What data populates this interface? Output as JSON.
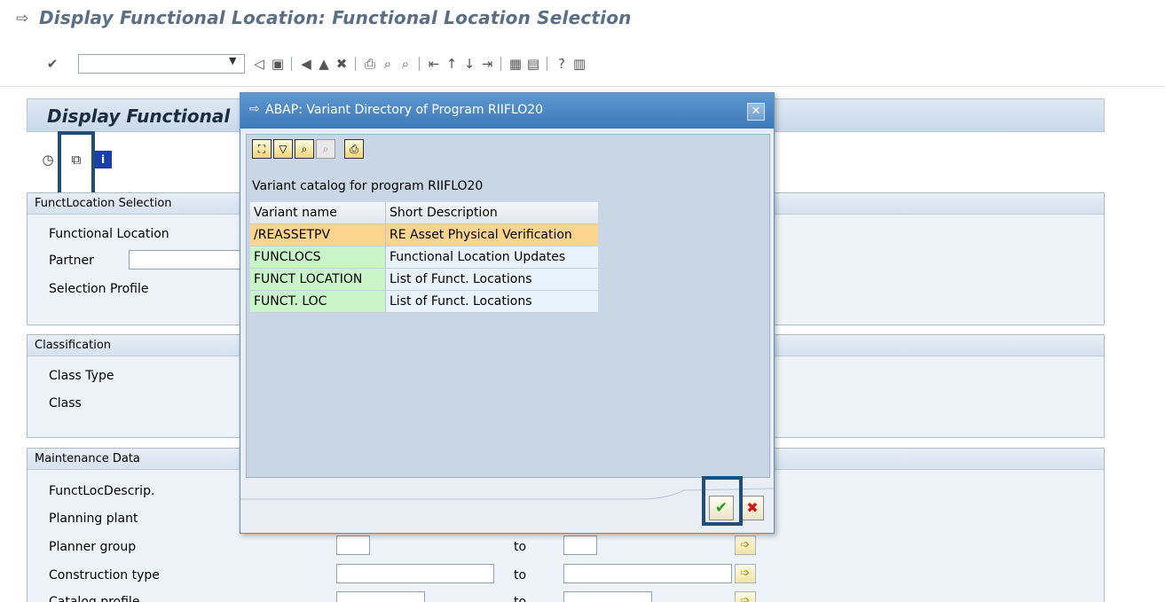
{
  "window": {
    "title": "Display Functional Location: Functional Location Selection",
    "title_icon": "exit-arrow-icon"
  },
  "toolbar": {
    "command_field": {
      "value": ""
    },
    "icons": [
      "enter-check-icon",
      "back-triangle-icon",
      "save-icon",
      "back-icon",
      "exit-icon",
      "cancel-icon",
      "print-icon",
      "find-icon",
      "find-next-icon",
      "first-page-icon",
      "previous-page-icon",
      "next-page-icon",
      "last-page-icon",
      "create-session-icon",
      "shortcut-icon",
      "help-icon",
      "layout-menu-icon"
    ]
  },
  "screen": {
    "header": "Display Functional"
  },
  "app_toolbar": {
    "icons": [
      "execute-clock-icon",
      "get-variant-icon",
      "info-icon"
    ]
  },
  "groups": {
    "selection": {
      "title": "FunctLocation Selection",
      "fields": [
        "Functional Location",
        "Partner",
        "Selection Profile"
      ]
    },
    "classification": {
      "title": "Classification",
      "fields": [
        "Class Type",
        "Class"
      ]
    },
    "maintenance": {
      "title": "Maintenance Data",
      "fields": [
        "FunctLocDescrip.",
        "Planning plant",
        "Planner group",
        "Construction type",
        "Catalog profile"
      ],
      "to_label": "to"
    }
  },
  "dialog": {
    "title": "ABAP: Variant Directory of Program RIIFLO20",
    "catalog_label": "Variant catalog for program RIIFLO20",
    "columns": [
      "Variant name",
      "Short Description"
    ],
    "rows": [
      {
        "name": "/REASSETPV",
        "desc": "RE Asset Physical Verification"
      },
      {
        "name": "FUNCLOCS",
        "desc": "Functional Location Updates"
      },
      {
        "name": "FUNCT LOCATION",
        "desc": "List of Funct. Locations"
      },
      {
        "name": "FUNCT. LOC",
        "desc": "List of Funct. Locations"
      }
    ]
  }
}
